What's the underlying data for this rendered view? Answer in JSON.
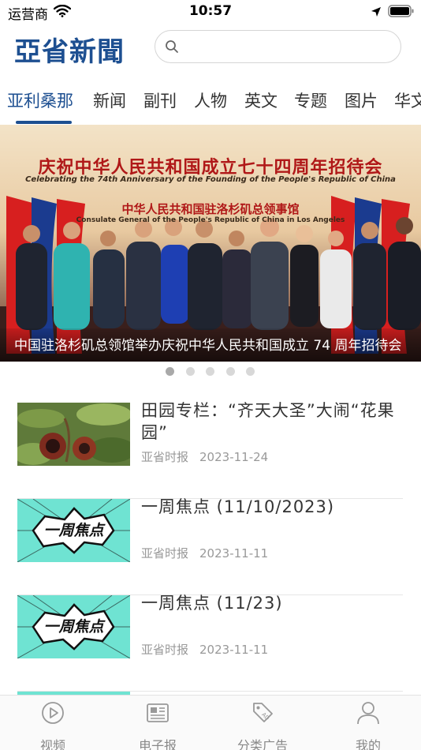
{
  "status_bar": {
    "carrier": "运营商",
    "time": "10:57"
  },
  "header": {
    "logo": "亞省新聞",
    "search_placeholder": ""
  },
  "tabs": [
    {
      "label": "亚利桑那",
      "active": true
    },
    {
      "label": "新闻"
    },
    {
      "label": "副刊"
    },
    {
      "label": "人物"
    },
    {
      "label": "英文"
    },
    {
      "label": "专题"
    },
    {
      "label": "图片"
    },
    {
      "label": "华文"
    }
  ],
  "banner": {
    "title": "庆祝中华人民共和国成立七十四周年招待会",
    "subtitle": "Celebrating the 74th Anniversary of the Founding of the People's Republic of China",
    "org": "中华人民共和国驻洛杉矶总领事馆",
    "org_en": "Consulate General of the People's Republic of China in Los Angeles",
    "caption": "中国驻洛杉矶总领馆举办庆祝中华人民共和国成立 74 周年招待会",
    "slide_count": 5,
    "active_slide": 1
  },
  "news": [
    {
      "title": "田园专栏：“齐天大圣”大闹“花果园”",
      "source": "亚省时报",
      "date": "2023-11-24"
    },
    {
      "title": "一周焦点 (11/10/2023)",
      "source": "亚省时报",
      "date": "2023-11-11",
      "thumb_text": "一周焦点"
    },
    {
      "title": "一周焦点 (11/23)",
      "source": "亚省时报",
      "date": "2023-11-11",
      "thumb_text": "一周焦点"
    }
  ],
  "bottom_nav": [
    {
      "label": "视频",
      "icon": "play-icon"
    },
    {
      "label": "电子报",
      "icon": "newspaper-icon"
    },
    {
      "label": "分类广告",
      "icon": "tag-icon"
    },
    {
      "label": "我的",
      "icon": "user-icon"
    }
  ],
  "colors": {
    "brand": "#1d4f91",
    "thumb_comic": "#6fe3d2"
  }
}
